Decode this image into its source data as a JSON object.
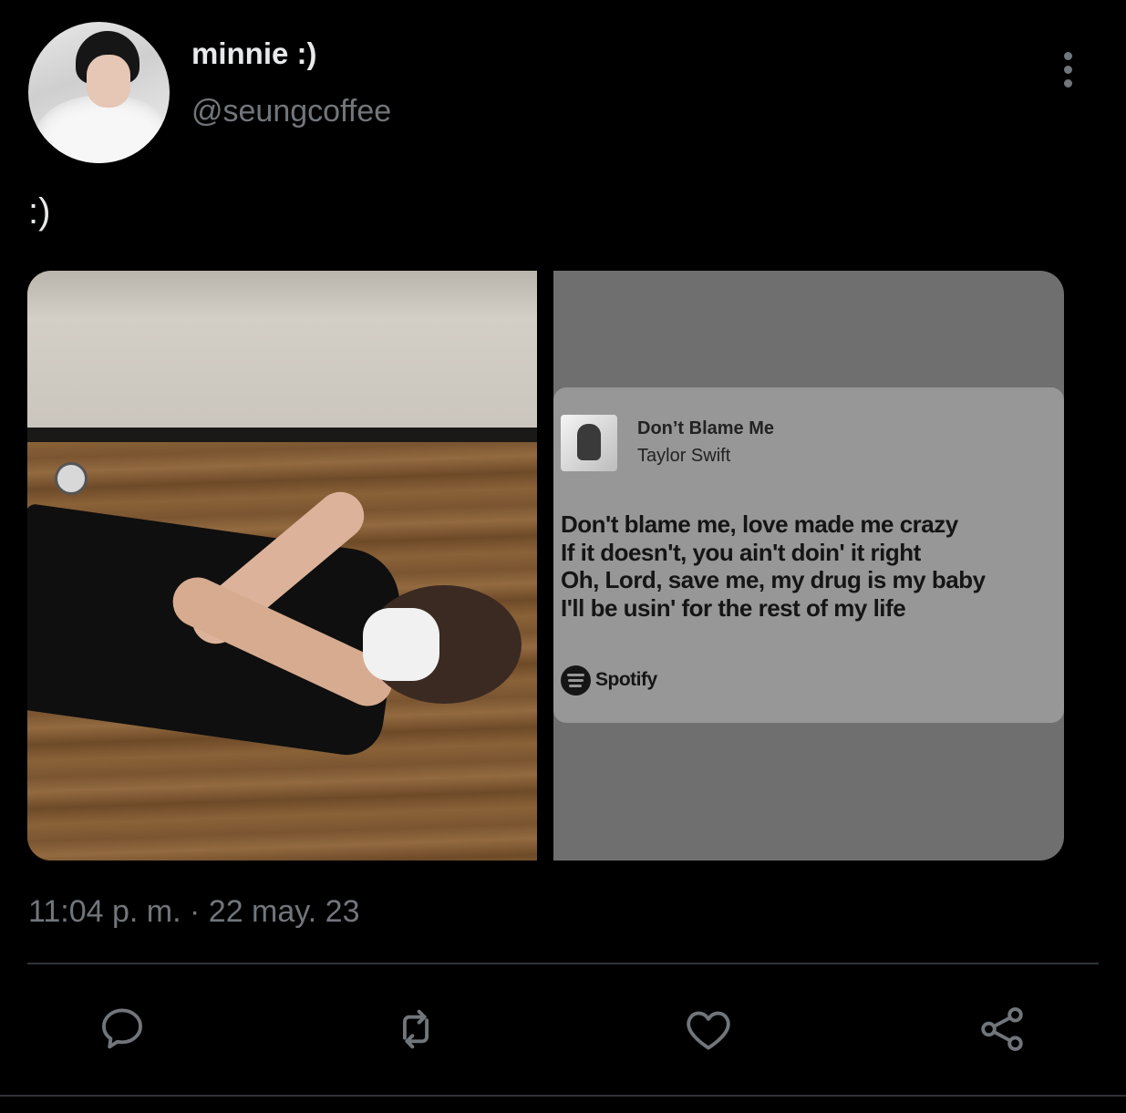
{
  "author": {
    "display_name": "minnie :)",
    "handle": "@seungcoffee"
  },
  "tweet": {
    "text": ":)",
    "timestamp": "11:04 p. m. · 22 may. 23"
  },
  "lyric_card": {
    "song_title": "Don’t Blame Me",
    "artist": "Taylor Swift",
    "lyrics": [
      "Don't blame me, love made me crazy",
      "If it doesn't, you ain't doin' it right",
      "Oh, Lord, save me, my drug is my baby",
      "I'll be usin' for the rest of my life"
    ],
    "brand": "Spotify"
  },
  "actions": {
    "icons": [
      "reply-icon",
      "retweet-icon",
      "like-icon",
      "share-icon"
    ]
  },
  "colors": {
    "background": "#000000",
    "primary_text": "#e7e9ea",
    "secondary_text": "#71767b",
    "divider": "#2f3336"
  }
}
